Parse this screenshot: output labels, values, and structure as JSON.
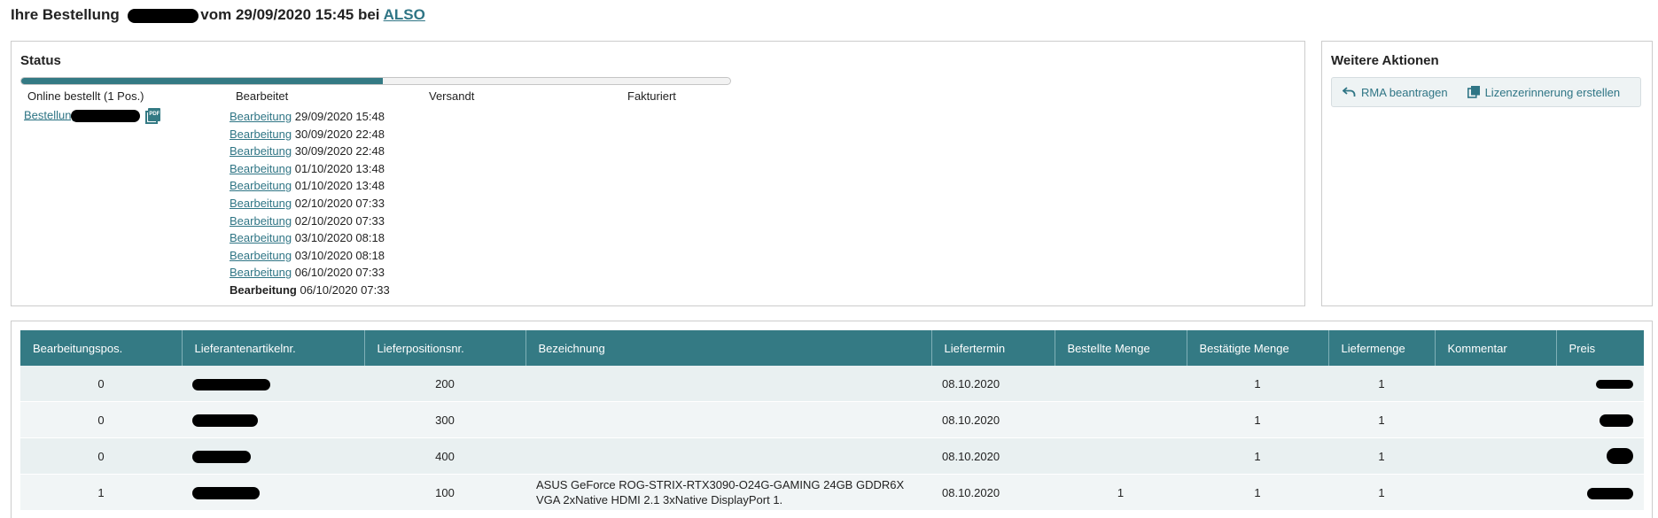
{
  "header": {
    "prefix": "Ihre Bestellung",
    "middle": "vom 29/09/2020 15:45 bei",
    "supplier": "ALSO"
  },
  "status": {
    "title": "Status",
    "progress": 0.51,
    "steps": [
      "Online bestellt (1 Pos.)",
      "Bearbeitet",
      "Versandt",
      "Fakturiert"
    ],
    "order_link": "Bestellung",
    "pdf_label": "PDF",
    "events": [
      {
        "label": "Bearbeitung",
        "date": "29/09/2020 15:48"
      },
      {
        "label": "Bearbeitung",
        "date": "30/09/2020 22:48"
      },
      {
        "label": "Bearbeitung",
        "date": "30/09/2020 22:48"
      },
      {
        "label": "Bearbeitung",
        "date": "01/10/2020 13:48"
      },
      {
        "label": "Bearbeitung",
        "date": "01/10/2020 13:48"
      },
      {
        "label": "Bearbeitung",
        "date": "02/10/2020 07:33"
      },
      {
        "label": "Bearbeitung",
        "date": "02/10/2020 07:33"
      },
      {
        "label": "Bearbeitung",
        "date": "03/10/2020 08:18"
      },
      {
        "label": "Bearbeitung",
        "date": "03/10/2020 08:18"
      },
      {
        "label": "Bearbeitung",
        "date": "06/10/2020 07:33"
      },
      {
        "label": "Bearbeitung",
        "date": "06/10/2020 07:33"
      }
    ]
  },
  "actions": {
    "title": "Weitere Aktionen",
    "rma": "RMA beantragen",
    "license": "Lizenzerinnerung erstellen"
  },
  "table": {
    "headers": [
      "Bearbeitungspos.",
      "Lieferantenartikelnr.",
      "Lieferpositionsnr.",
      "Bezeichnung",
      "Liefertermin",
      "Bestellte Menge",
      "Bestätigte Menge",
      "Liefermenge",
      "Kommentar",
      "Preis"
    ],
    "rows": [
      {
        "pos": "0",
        "lpos": "200",
        "desc": "",
        "date": "08.10.2020",
        "ordered": "",
        "confirmed": "1",
        "delivered": "1",
        "comment": ""
      },
      {
        "pos": "0",
        "lpos": "300",
        "desc": "",
        "date": "08.10.2020",
        "ordered": "",
        "confirmed": "1",
        "delivered": "1",
        "comment": ""
      },
      {
        "pos": "0",
        "lpos": "400",
        "desc": "",
        "date": "08.10.2020",
        "ordered": "",
        "confirmed": "1",
        "delivered": "1",
        "comment": ""
      },
      {
        "pos": "1",
        "lpos": "100",
        "desc": "ASUS GeForce ROG-STRIX-RTX3090-O24G-GAMING 24GB GDDR6X VGA 2xNative HDMI 2.1 3xNative DisplayPort 1.",
        "date": "08.10.2020",
        "ordered": "1",
        "confirmed": "1",
        "delivered": "1",
        "comment": ""
      }
    ]
  },
  "colors": {
    "accent": "#347a84",
    "link": "#2f7585",
    "row_bg": "#e9f0f1"
  }
}
